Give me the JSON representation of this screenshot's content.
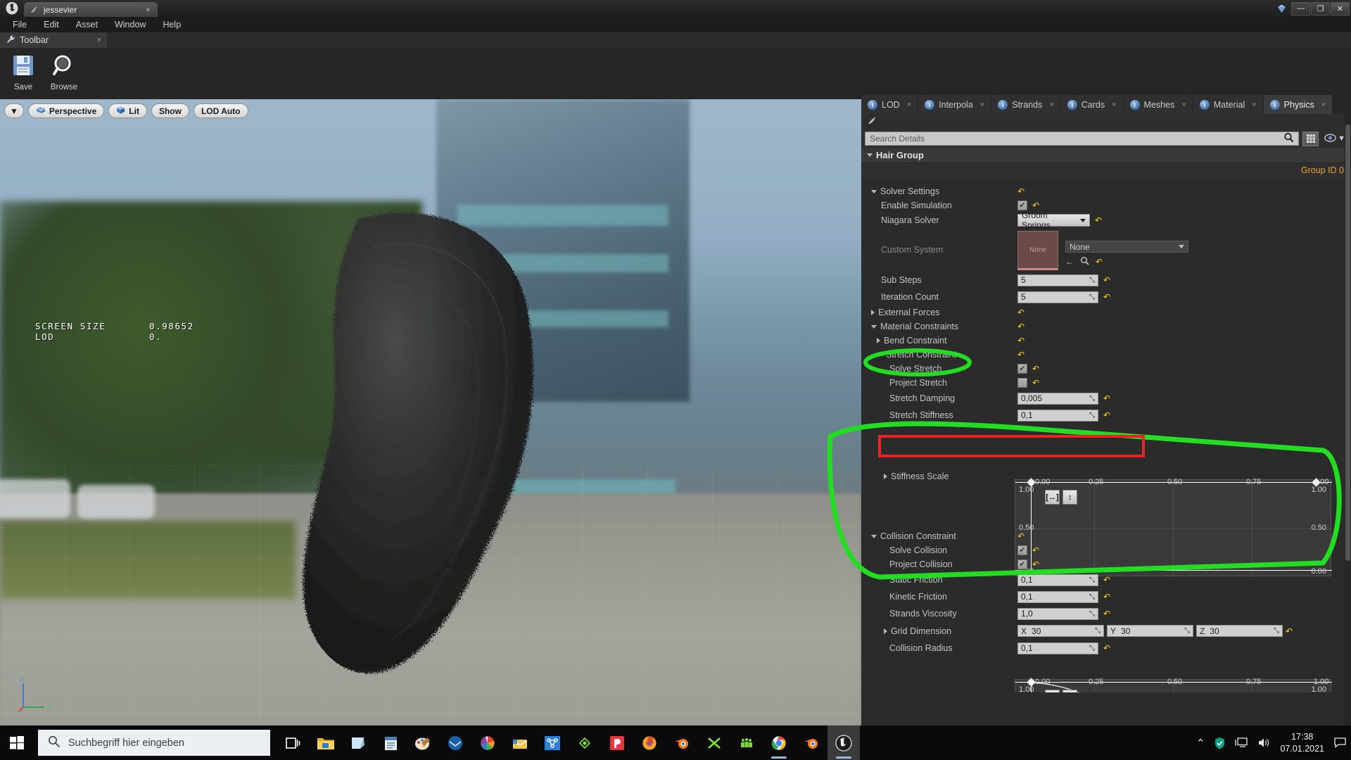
{
  "window": {
    "tab_title": "jessevier",
    "tab_close": "×",
    "minimize": "—",
    "maximize": "❐",
    "close": "✕"
  },
  "menu": {
    "items": [
      "File",
      "Edit",
      "Asset",
      "Window",
      "Help"
    ]
  },
  "toolbar_panel": {
    "tab_label": "Toolbar",
    "tab_close": "×",
    "buttons": [
      {
        "label": "Save",
        "icon": "floppy-disk-icon"
      },
      {
        "label": "Browse",
        "icon": "magnifier-icon"
      }
    ]
  },
  "viewport": {
    "toolbar": {
      "menu_arrow": "▼",
      "perspective": "Perspective",
      "lit": "Lit",
      "show": "Show",
      "lod": "LOD Auto"
    },
    "stats": [
      {
        "key": "SCREEN SIZE",
        "value": "0.98652"
      },
      {
        "key": "LOD",
        "value": "0."
      }
    ],
    "gizmo": {
      "z": "Z",
      "x": "X",
      "y": "Y"
    }
  },
  "details": {
    "tabs": [
      {
        "label": "LOD",
        "active": false
      },
      {
        "label": "Interpola",
        "active": false
      },
      {
        "label": "Strands",
        "active": false
      },
      {
        "label": "Cards",
        "active": false
      },
      {
        "label": "Meshes",
        "active": false
      },
      {
        "label": "Material",
        "active": false
      },
      {
        "label": "Physics",
        "active": true
      }
    ],
    "tab_close": "×",
    "search_placeholder": "Search Details",
    "search_value": "",
    "search_icon": "magnifier-icon",
    "grid_view_icon": "grid-view-icon",
    "eye_icon": "eye-icon",
    "eye_caret": "▼",
    "group_header": "Hair Group",
    "group_id": "Group ID 0",
    "revert_glyph": "↶",
    "check_glyph": "✔",
    "spin_glyph": "⤡",
    "sections": {
      "solver_settings": {
        "label": "Solver Settings",
        "enable_simulation": {
          "label": "Enable Simulation",
          "checked": true
        },
        "niagara_solver": {
          "label": "Niagara Solver",
          "value": "Groom Springs"
        },
        "custom_system": {
          "label": "Custom System",
          "thumb": "None",
          "value": "None"
        },
        "sub_steps": {
          "label": "Sub Steps",
          "value": "5"
        },
        "iteration_count": {
          "label": "Iteration Count",
          "value": "5"
        }
      },
      "external_forces": {
        "label": "External Forces"
      },
      "material_constraints": {
        "label": "Material Constraints",
        "bend_constraint": {
          "label": "Bend Constraint"
        },
        "stretch_constraint": {
          "label": "Stretch Constraint",
          "solve_stretch": {
            "label": "Solve Stretch",
            "checked": true
          },
          "project_stretch": {
            "label": "Project Stretch",
            "checked": false
          },
          "stretch_damping": {
            "label": "Stretch Damping",
            "value": "0,005"
          },
          "stretch_stiffness": {
            "label": "Stretch Stiffness",
            "value": "0,1"
          },
          "stiffness_scale": {
            "label": "Stiffness Scale"
          }
        }
      },
      "collision_constraint": {
        "label": "Collision Constraint",
        "solve_collision": {
          "label": "Solve Collision",
          "checked": true
        },
        "project_collision": {
          "label": "Project Collision",
          "checked": true
        },
        "static_friction": {
          "label": "Static Friction",
          "value": "0,1"
        },
        "kinetic_friction": {
          "label": "Kinetic Friction",
          "value": "0,1"
        },
        "strands_viscosity": {
          "label": "Strands Viscosity",
          "value": "1,0"
        },
        "grid_dimension": {
          "label": "Grid Dimension",
          "x_label": "X",
          "x_value": "30",
          "y_label": "Y",
          "y_value": "30",
          "z_label": "Z",
          "z_value": "30"
        },
        "collision_radius": {
          "label": "Collision Radius",
          "value": "0,1"
        }
      }
    },
    "curve_editor": {
      "x_ticks": [
        "0.00",
        "0.25",
        "0.50",
        "0.75",
        "1.00"
      ],
      "y_ticks_left": [
        "1.00",
        "0.50",
        "0.00"
      ],
      "y_ticks_right": [
        "1.00",
        "0.50",
        "0.00"
      ],
      "pan_icon": "[↔]",
      "zoom_icon": "↕"
    }
  },
  "annotations": {
    "red_highlight_target": "Stretch Stiffness",
    "green_circle_targets": [
      "Bend Constraint",
      "Stiffness Scale curve"
    ],
    "red_color": "#ee2222",
    "green_color": "#22dd22"
  },
  "taskbar": {
    "start_icon": "windows-logo-icon",
    "search_placeholder": "Suchbegriff hier eingeben",
    "search_icon": "magnifier-icon",
    "taskview_icon": "task-view-icon",
    "apps": [
      "file-explorer-icon",
      "sticky-notes-icon",
      "notepad-icon",
      "paint-icon",
      "thunderbird-icon",
      "photos-icon",
      "mail-icon",
      "substance-icon",
      "marmoset-icon",
      "pixplant-icon",
      "firefox-icon",
      "blender-icon",
      "xnview-icon",
      "crowd-icon",
      "chrome-icon",
      "blender-icon-2",
      "unreal-icon"
    ],
    "tray": {
      "chevron": "⌃",
      "security_icon": "shield-icon",
      "network_icon": "monitor-icon",
      "volume_icon": "speaker-icon",
      "time": "17:38",
      "date": "07.01.2021",
      "notification_icon": "chat-icon"
    }
  }
}
